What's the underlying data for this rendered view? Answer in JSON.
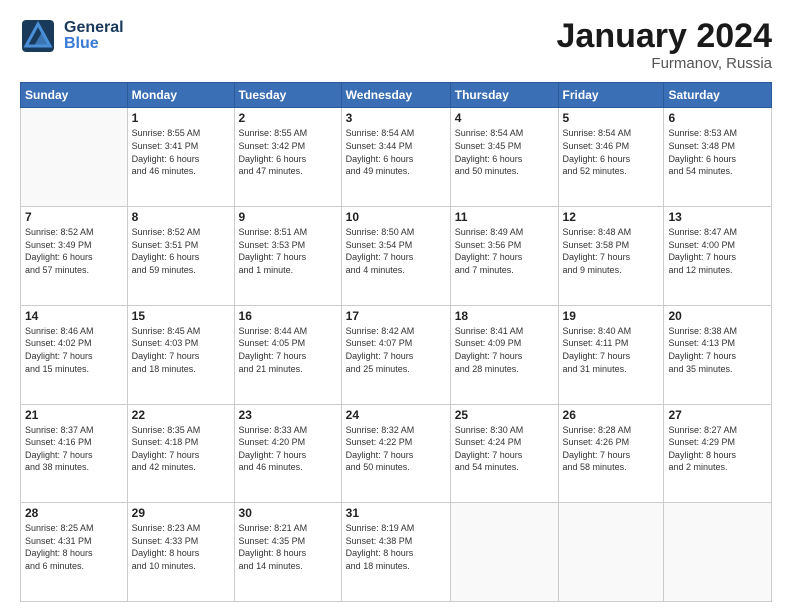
{
  "header": {
    "logo_general": "General",
    "logo_blue": "Blue",
    "month_title": "January 2024",
    "subtitle": "Furmanov, Russia"
  },
  "days_of_week": [
    "Sunday",
    "Monday",
    "Tuesday",
    "Wednesday",
    "Thursday",
    "Friday",
    "Saturday"
  ],
  "weeks": [
    [
      {
        "day": "",
        "info": ""
      },
      {
        "day": "1",
        "info": "Sunrise: 8:55 AM\nSunset: 3:41 PM\nDaylight: 6 hours\nand 46 minutes."
      },
      {
        "day": "2",
        "info": "Sunrise: 8:55 AM\nSunset: 3:42 PM\nDaylight: 6 hours\nand 47 minutes."
      },
      {
        "day": "3",
        "info": "Sunrise: 8:54 AM\nSunset: 3:44 PM\nDaylight: 6 hours\nand 49 minutes."
      },
      {
        "day": "4",
        "info": "Sunrise: 8:54 AM\nSunset: 3:45 PM\nDaylight: 6 hours\nand 50 minutes."
      },
      {
        "day": "5",
        "info": "Sunrise: 8:54 AM\nSunset: 3:46 PM\nDaylight: 6 hours\nand 52 minutes."
      },
      {
        "day": "6",
        "info": "Sunrise: 8:53 AM\nSunset: 3:48 PM\nDaylight: 6 hours\nand 54 minutes."
      }
    ],
    [
      {
        "day": "7",
        "info": "Sunrise: 8:52 AM\nSunset: 3:49 PM\nDaylight: 6 hours\nand 57 minutes."
      },
      {
        "day": "8",
        "info": "Sunrise: 8:52 AM\nSunset: 3:51 PM\nDaylight: 6 hours\nand 59 minutes."
      },
      {
        "day": "9",
        "info": "Sunrise: 8:51 AM\nSunset: 3:53 PM\nDaylight: 7 hours\nand 1 minute."
      },
      {
        "day": "10",
        "info": "Sunrise: 8:50 AM\nSunset: 3:54 PM\nDaylight: 7 hours\nand 4 minutes."
      },
      {
        "day": "11",
        "info": "Sunrise: 8:49 AM\nSunset: 3:56 PM\nDaylight: 7 hours\nand 7 minutes."
      },
      {
        "day": "12",
        "info": "Sunrise: 8:48 AM\nSunset: 3:58 PM\nDaylight: 7 hours\nand 9 minutes."
      },
      {
        "day": "13",
        "info": "Sunrise: 8:47 AM\nSunset: 4:00 PM\nDaylight: 7 hours\nand 12 minutes."
      }
    ],
    [
      {
        "day": "14",
        "info": "Sunrise: 8:46 AM\nSunset: 4:02 PM\nDaylight: 7 hours\nand 15 minutes."
      },
      {
        "day": "15",
        "info": "Sunrise: 8:45 AM\nSunset: 4:03 PM\nDaylight: 7 hours\nand 18 minutes."
      },
      {
        "day": "16",
        "info": "Sunrise: 8:44 AM\nSunset: 4:05 PM\nDaylight: 7 hours\nand 21 minutes."
      },
      {
        "day": "17",
        "info": "Sunrise: 8:42 AM\nSunset: 4:07 PM\nDaylight: 7 hours\nand 25 minutes."
      },
      {
        "day": "18",
        "info": "Sunrise: 8:41 AM\nSunset: 4:09 PM\nDaylight: 7 hours\nand 28 minutes."
      },
      {
        "day": "19",
        "info": "Sunrise: 8:40 AM\nSunset: 4:11 PM\nDaylight: 7 hours\nand 31 minutes."
      },
      {
        "day": "20",
        "info": "Sunrise: 8:38 AM\nSunset: 4:13 PM\nDaylight: 7 hours\nand 35 minutes."
      }
    ],
    [
      {
        "day": "21",
        "info": "Sunrise: 8:37 AM\nSunset: 4:16 PM\nDaylight: 7 hours\nand 38 minutes."
      },
      {
        "day": "22",
        "info": "Sunrise: 8:35 AM\nSunset: 4:18 PM\nDaylight: 7 hours\nand 42 minutes."
      },
      {
        "day": "23",
        "info": "Sunrise: 8:33 AM\nSunset: 4:20 PM\nDaylight: 7 hours\nand 46 minutes."
      },
      {
        "day": "24",
        "info": "Sunrise: 8:32 AM\nSunset: 4:22 PM\nDaylight: 7 hours\nand 50 minutes."
      },
      {
        "day": "25",
        "info": "Sunrise: 8:30 AM\nSunset: 4:24 PM\nDaylight: 7 hours\nand 54 minutes."
      },
      {
        "day": "26",
        "info": "Sunrise: 8:28 AM\nSunset: 4:26 PM\nDaylight: 7 hours\nand 58 minutes."
      },
      {
        "day": "27",
        "info": "Sunrise: 8:27 AM\nSunset: 4:29 PM\nDaylight: 8 hours\nand 2 minutes."
      }
    ],
    [
      {
        "day": "28",
        "info": "Sunrise: 8:25 AM\nSunset: 4:31 PM\nDaylight: 8 hours\nand 6 minutes."
      },
      {
        "day": "29",
        "info": "Sunrise: 8:23 AM\nSunset: 4:33 PM\nDaylight: 8 hours\nand 10 minutes."
      },
      {
        "day": "30",
        "info": "Sunrise: 8:21 AM\nSunset: 4:35 PM\nDaylight: 8 hours\nand 14 minutes."
      },
      {
        "day": "31",
        "info": "Sunrise: 8:19 AM\nSunset: 4:38 PM\nDaylight: 8 hours\nand 18 minutes."
      },
      {
        "day": "",
        "info": ""
      },
      {
        "day": "",
        "info": ""
      },
      {
        "day": "",
        "info": ""
      }
    ]
  ]
}
